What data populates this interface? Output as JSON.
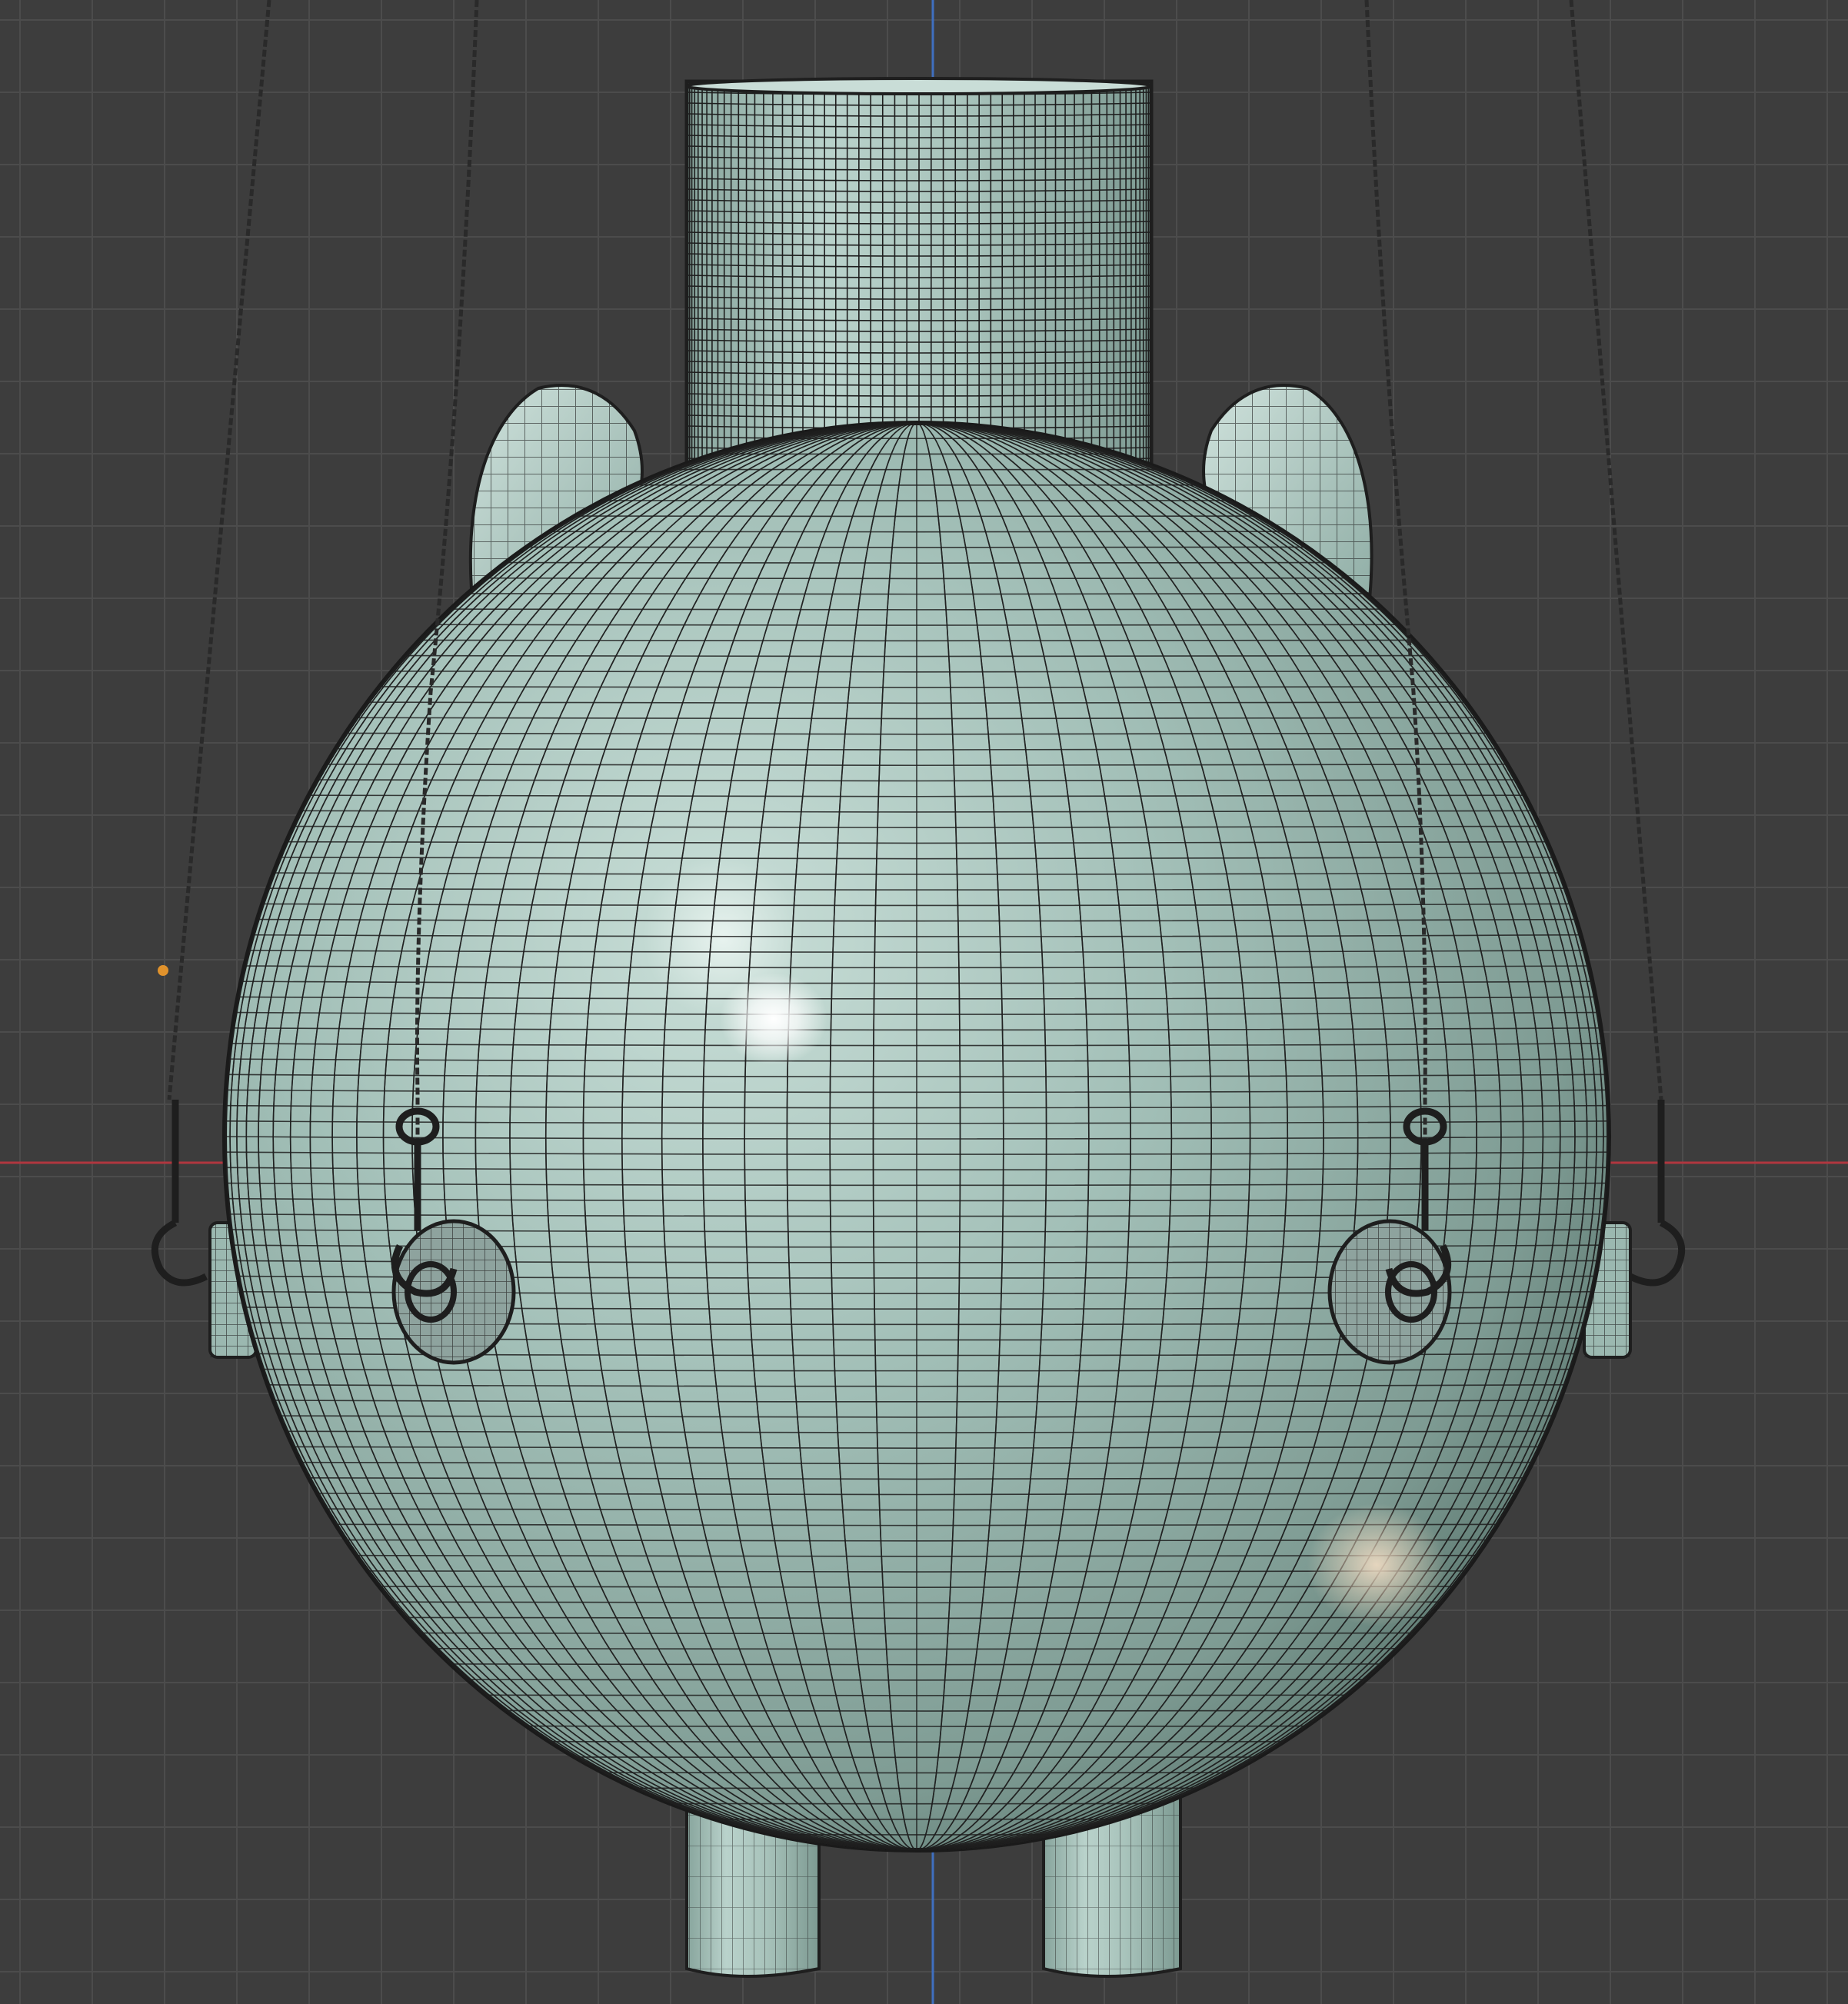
{
  "viewport": {
    "mode": "3d-viewport-wireframe-overlay",
    "view": "front-orthographic"
  },
  "colors": {
    "background": "#3d3d3d",
    "grid_line": "#4c4c4c",
    "axis_x": "#b0363f",
    "axis_z": "#3f6fbf",
    "mesh_fill": "#9bb8b0",
    "mesh_fill_light": "#c7dcd6",
    "mesh_fill_dark": "#5f7a73",
    "wire": "#1e1e1e",
    "cable": "#2a2a2a",
    "origin_dot": "#e0922c"
  },
  "icons": [
    "origin-point-icon"
  ],
  "scene": {
    "objects": [
      "spherical-buoy-body",
      "top-cylinder-neck",
      "left-fin",
      "right-fin",
      "left-leg",
      "right-leg",
      "left-side-bracket",
      "right-side-bracket",
      "left-pulley-disc",
      "right-pulley-disc",
      "outer-left-cable",
      "inner-left-cable",
      "inner-right-cable",
      "outer-right-cable"
    ]
  }
}
